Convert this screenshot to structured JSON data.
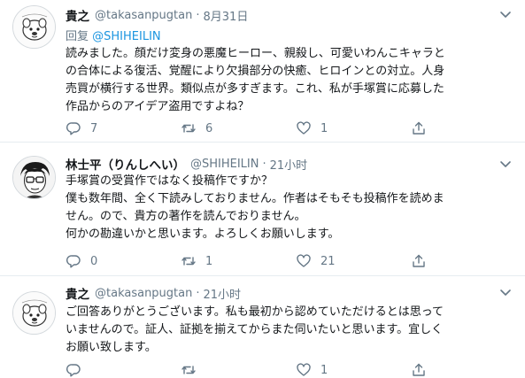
{
  "tweets": [
    {
      "name": "貴之",
      "handle": "@takasanpugtan",
      "time": "8月31日",
      "reply_prefix": "回复",
      "reply_mention": "@SHIHEILIN",
      "lines": [
        "読みました。顔だけ変身の悪魔ヒーロー、親殺し、可愛いわんこキャラと",
        "の合体による復活、覚醒により欠損部分の快癒、ヒロインとの対立。人身",
        "売買が横行する世界。類似点が多すぎます。これ、私が手塚賞に応募した",
        "作品からのアイデア盗用ですよね？"
      ],
      "reply_count": "7",
      "retweet_count": "6",
      "like_count": "1"
    },
    {
      "name": "林士平（りんしへい）",
      "handle": "@SHIHEILIN",
      "time": "21小时",
      "lines": [
        "手塚賞の受賞作ではなく投稿作ですか？",
        "僕も数年間、全く下読みしておりません。作者はそもそも投稿作を読めま",
        "せん。ので、貴方の著作を読んでおりません。",
        "何かの勘違いかと思います。よろしくお願いします。"
      ],
      "reply_count": "0",
      "retweet_count": "1",
      "like_count": "21"
    },
    {
      "name": "貴之",
      "handle": "@takasanpugtan",
      "time": "21小时",
      "lines": [
        "ご回答ありがとうございます。私も最初から認めていただけるとは思って",
        "いませんので。証人、証拠を揃えてからまた伺いたいと思います。宜しく",
        "お願い致します。"
      ],
      "reply_count": "",
      "retweet_count": "",
      "like_count": "1"
    }
  ],
  "colors": {
    "link": "#1b95e0",
    "secondary": "#657786",
    "text": "#14171a",
    "divider": "#e6ecf0"
  },
  "icons": {
    "reply": "reply-icon",
    "retweet": "retweet-icon",
    "like": "heart-icon",
    "share": "share-icon",
    "caret": "chevron-down-icon"
  }
}
